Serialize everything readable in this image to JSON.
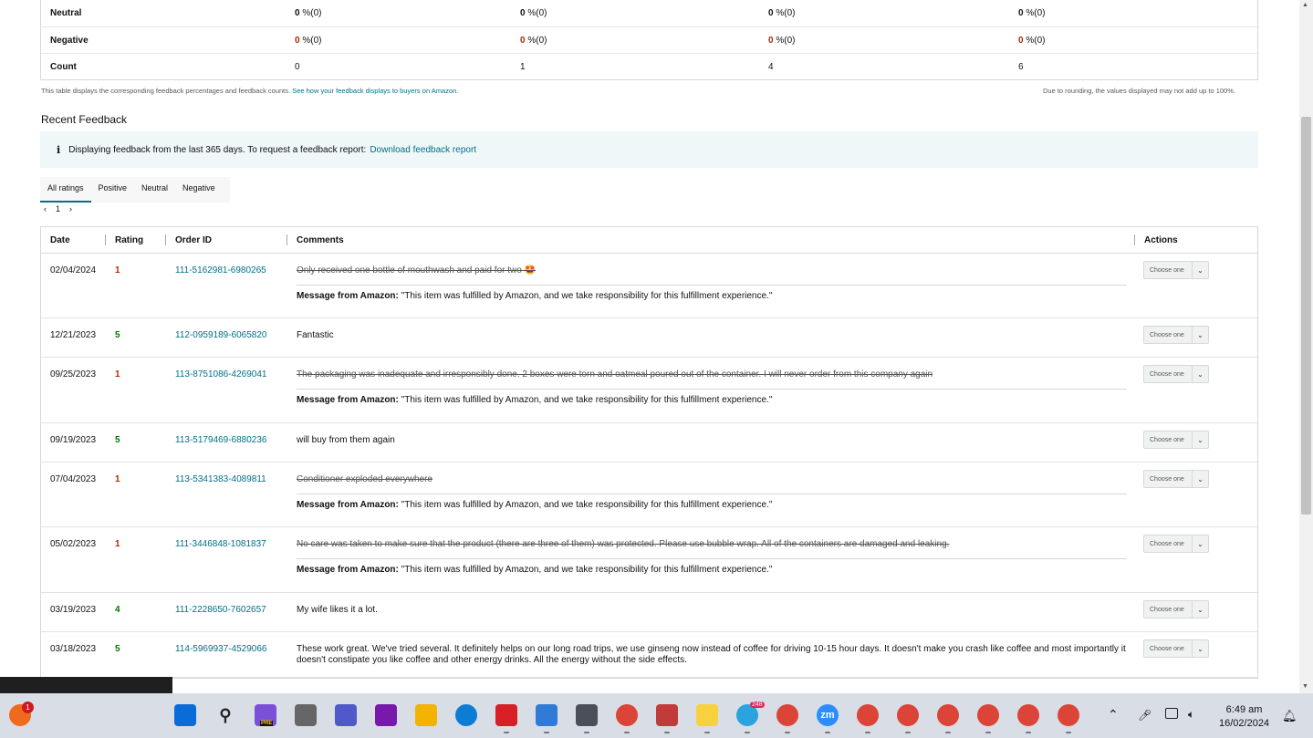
{
  "summary": {
    "rows": [
      {
        "label": "Neutral",
        "cells": [
          [
            "0",
            " %(0)"
          ],
          [
            "0",
            " %(0)"
          ],
          [
            "0",
            " %(0)"
          ],
          [
            "0",
            " %(0)"
          ]
        ],
        "red": false
      },
      {
        "label": "Negative",
        "cells": [
          [
            "0",
            " %(0)"
          ],
          [
            "0",
            " %(0)"
          ],
          [
            "0",
            " %(0)"
          ],
          [
            "0",
            " %(0)"
          ]
        ],
        "red": true
      },
      {
        "label": "Count",
        "cells": [
          [
            "",
            "0"
          ],
          [
            "",
            "1"
          ],
          [
            "",
            "4"
          ],
          [
            "",
            "6"
          ]
        ],
        "red": false
      }
    ],
    "note_left": "This table displays the corresponding feedback percentages and feedback counts.",
    "note_link": "See how your feedback displays to buyers on Amazon.",
    "note_right": "Due to rounding, the values displayed may not add up to 100%."
  },
  "recent": {
    "title": "Recent Feedback",
    "info_icon": "i",
    "info_text": "Displaying feedback from the last 365 days. To request a feedback report:",
    "info_link": "Download feedback report",
    "tabs": [
      "All ratings",
      "Positive",
      "Neutral",
      "Negative"
    ],
    "pager": {
      "prev": "‹",
      "page": "1",
      "next": "›"
    }
  },
  "table": {
    "headers": {
      "date": "Date",
      "rating": "Rating",
      "order": "Order ID",
      "comments": "Comments",
      "actions": "Actions"
    },
    "select_label": "Choose one",
    "msg_label": "Message from Amazon:",
    "msg_text": "\"This item was fulfilled by Amazon, and we take responsibility for this fulfillment experience.\"",
    "rows": [
      {
        "date": "02/04/2024",
        "rating": "1",
        "order": "111-5162981-6980265",
        "comment": "Only received one bottle of mouthwash and paid for two 🤩",
        "struck": true,
        "message": true
      },
      {
        "date": "12/21/2023",
        "rating": "5",
        "order": "112-0959189-6065820",
        "comment": "Fantastic",
        "struck": false,
        "message": false
      },
      {
        "date": "09/25/2023",
        "rating": "1",
        "order": "113-8751086-4269041",
        "comment": "The packaging was inadequate and irresponsibly done. 2 boxes were torn and oatmeal poured out of the container. I will never order from this company again",
        "struck": true,
        "message": true
      },
      {
        "date": "09/19/2023",
        "rating": "5",
        "order": "113-5179469-6880236",
        "comment": "will buy from them again",
        "struck": false,
        "message": false
      },
      {
        "date": "07/04/2023",
        "rating": "1",
        "order": "113-5341383-4089811",
        "comment": "Conditioner exploded everywhere",
        "struck": true,
        "message": true
      },
      {
        "date": "05/02/2023",
        "rating": "1",
        "order": "111-3446848-1081837",
        "comment": "No care was taken to make sure that the product (there are three of them) was protected. Please use bubble wrap. All of the containers are damaged and leaking.",
        "struck": true,
        "message": true
      },
      {
        "date": "03/19/2023",
        "rating": "4",
        "order": "111-2228650-7602657",
        "comment": "My wife likes it a lot.",
        "struck": false,
        "message": false
      },
      {
        "date": "03/18/2023",
        "rating": "5",
        "order": "114-5969937-4529066",
        "comment": "These work great. We've tried several. It definitely helps on our long road trips, we use ginseng now instead of coffee for driving 10-15 hour days. It doesn't make you crash like coffee and most importantly it doesn't constipate you like coffee and other energy drinks. All the energy without the side effects.",
        "struck": false,
        "message": false
      }
    ]
  },
  "taskbar": {
    "badge_firefox": "1",
    "badge_telegram": "248",
    "pre_label": "PRE",
    "zoom_label": "zm",
    "time": "6:49 am",
    "date": "16/02/2024",
    "icons": [
      {
        "name": "start-icon",
        "color": "#0a6cd9"
      },
      {
        "name": "search-icon",
        "color": "none"
      },
      {
        "name": "copilot-icon",
        "color": "#7b4fd8"
      },
      {
        "name": "task-view-icon",
        "color": "#666666"
      },
      {
        "name": "teams-icon",
        "color": "#5059c9"
      },
      {
        "name": "onenote-icon",
        "color": "#7719aa"
      },
      {
        "name": "file-explorer-icon",
        "color": "#f2b400"
      },
      {
        "name": "edge-icon",
        "color": "#0c7cd5"
      },
      {
        "name": "netflix-icon",
        "color": "#d81f26"
      },
      {
        "name": "notepad-icon",
        "color": "#2f7bd6"
      },
      {
        "name": "calculator-icon",
        "color": "#4a4f5a"
      },
      {
        "name": "chrome-icon",
        "color": "#db4437"
      },
      {
        "name": "snipping-tool-icon",
        "color": "#c23b3b"
      },
      {
        "name": "sticky-notes-icon",
        "color": "#f7d23e"
      },
      {
        "name": "telegram-icon",
        "color": "#2aa3df"
      },
      {
        "name": "chrome-profile-icon",
        "color": "#db4437"
      },
      {
        "name": "zoom-icon",
        "color": "#2d8cff"
      },
      {
        "name": "chrome-profile-icon",
        "color": "#db4437"
      },
      {
        "name": "chrome-profile-icon",
        "color": "#db4437"
      },
      {
        "name": "chrome-profile-icon",
        "color": "#db4437"
      },
      {
        "name": "chrome-profile-icon",
        "color": "#db4437"
      },
      {
        "name": "chrome-profile-icon",
        "color": "#db4437"
      },
      {
        "name": "chrome-profile-icon",
        "color": "#db4437"
      }
    ]
  }
}
